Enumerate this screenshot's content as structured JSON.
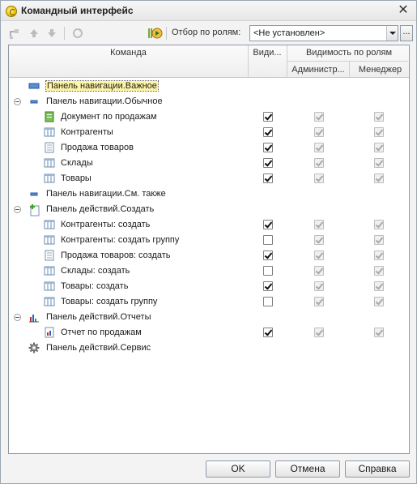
{
  "window": {
    "title": "Командный интерфейс"
  },
  "toolbar": {
    "filter_label": "Отбор по ролям:",
    "filter_value": "<Не установлен>",
    "more_label": "..."
  },
  "grid": {
    "col_command": "Команда",
    "col_visible": "Види...",
    "col_visibility_by_roles": "Видимость по ролям",
    "col_admin": "Администр...",
    "col_manager": "Менеджер"
  },
  "rows": [
    {
      "label": "Панель навигации.Важное",
      "level": 0,
      "icon": "nav-panel-important-icon",
      "expander": false,
      "selected": true,
      "checks": null
    },
    {
      "label": "Панель навигации.Обычное",
      "level": 0,
      "icon": "nav-panel-normal-icon",
      "expander": true,
      "checks": null
    },
    {
      "label": "Документ по продажам",
      "level": 1,
      "icon": "document-icon",
      "checks": [
        true,
        true,
        true
      ]
    },
    {
      "label": "Контрагенты",
      "level": 1,
      "icon": "catalog-icon",
      "checks": [
        true,
        true,
        true
      ]
    },
    {
      "label": "Продажа товаров",
      "level": 1,
      "icon": "list-icon",
      "checks": [
        true,
        true,
        true
      ]
    },
    {
      "label": "Склады",
      "level": 1,
      "icon": "catalog-icon",
      "checks": [
        true,
        true,
        true
      ]
    },
    {
      "label": "Товары",
      "level": 1,
      "icon": "catalog-icon",
      "checks": [
        true,
        true,
        true
      ]
    },
    {
      "label": "Панель навигации.См. также",
      "level": 0,
      "icon": "nav-panel-seealso-icon",
      "expander": false,
      "checks": null
    },
    {
      "label": "Панель действий.Создать",
      "level": 0,
      "icon": "actions-create-icon",
      "expander": true,
      "checks": null
    },
    {
      "label": "Контрагенты: создать",
      "level": 1,
      "icon": "catalog-icon",
      "checks": [
        true,
        true,
        true
      ]
    },
    {
      "label": "Контрагенты: создать группу",
      "level": 1,
      "icon": "catalog-icon",
      "checks": [
        false,
        true,
        true
      ]
    },
    {
      "label": "Продажа товаров: создать",
      "level": 1,
      "icon": "list-icon",
      "checks": [
        true,
        true,
        true
      ]
    },
    {
      "label": "Склады: создать",
      "level": 1,
      "icon": "catalog-icon",
      "checks": [
        false,
        true,
        true
      ]
    },
    {
      "label": "Товары: создать",
      "level": 1,
      "icon": "catalog-icon",
      "checks": [
        true,
        true,
        true
      ]
    },
    {
      "label": "Товары: создать группу",
      "level": 1,
      "icon": "catalog-icon",
      "checks": [
        false,
        true,
        true
      ]
    },
    {
      "label": "Панель действий.Отчеты",
      "level": 0,
      "icon": "actions-reports-icon",
      "expander": true,
      "checks": null
    },
    {
      "label": "Отчет по продажам",
      "level": 1,
      "icon": "report-icon",
      "checks": [
        true,
        true,
        true
      ]
    },
    {
      "label": "Панель действий.Сервис",
      "level": 0,
      "icon": "gear-icon",
      "expander": false,
      "checks": null
    }
  ],
  "buttons": {
    "ok": "OK",
    "cancel": "Отмена",
    "help": "Справка"
  }
}
